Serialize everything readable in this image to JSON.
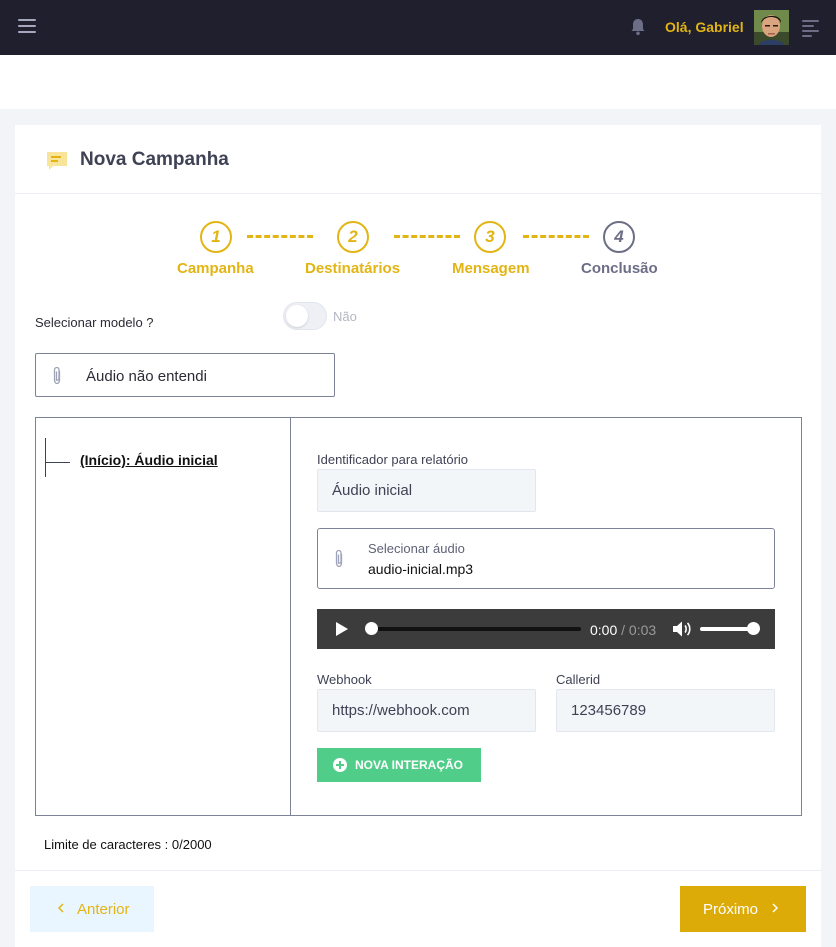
{
  "header": {
    "greeting": "Olá, Gabriel"
  },
  "page": {
    "title": "Nova Campanha"
  },
  "steps": [
    {
      "number": "1",
      "label": "Campanha",
      "state": "active"
    },
    {
      "number": "2",
      "label": "Destinatários",
      "state": "active"
    },
    {
      "number": "3",
      "label": "Mensagem",
      "state": "active"
    },
    {
      "number": "4",
      "label": "Conclusão",
      "state": "inactive"
    }
  ],
  "template": {
    "label": "Selecionar modelo ?",
    "toggle_value": "Não",
    "file_name": "Áudio não entendi"
  },
  "flow": {
    "tree_node": "(Início): Áudio inicial",
    "identifier_label": "Identificador para relatório",
    "identifier_value": "Áudio inicial",
    "audio_label": "Selecionar áudio",
    "audio_file": "audio-inicial.mp3",
    "player": {
      "current": "0:00",
      "separator": " / ",
      "duration": "0:03"
    },
    "webhook_label": "Webhook",
    "webhook_value": "https://webhook.com",
    "callerid_label": "Callerid",
    "callerid_value": "123456789",
    "new_interaction_label": "NOVA INTERAÇÃO"
  },
  "limit_text": "Limite de caracteres : 0/2000",
  "nav": {
    "prev_label": "Anterior",
    "next_label": "Próximo"
  },
  "colors": {
    "accent": "#e2b514",
    "primary_button": "#dcab07",
    "success": "#50cd89",
    "topbar": "#1f1f2e"
  },
  "icons": [
    "menu-icon",
    "bell-icon",
    "avatar",
    "menu-lines-icon",
    "message-icon",
    "paperclip-icon",
    "play-icon",
    "volume-icon",
    "plus-circle-icon",
    "arrow-left-icon",
    "arrow-right-icon"
  ]
}
